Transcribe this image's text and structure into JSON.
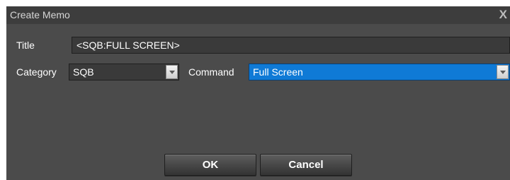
{
  "dialog": {
    "title": "Create Memo",
    "close_glyph": "X"
  },
  "form": {
    "title_label": "Title",
    "title_value": "<SQB:FULL SCREEN>",
    "category_label": "Category",
    "category_value": "SQB",
    "command_label": "Command",
    "command_value": "Full Screen"
  },
  "buttons": {
    "ok_label": "OK",
    "cancel_label": "Cancel"
  },
  "colors": {
    "dialog_bg": "#4b4b4b",
    "titlebar_bg": "#3d3d3d",
    "selection_blue": "#0f7ad6"
  }
}
